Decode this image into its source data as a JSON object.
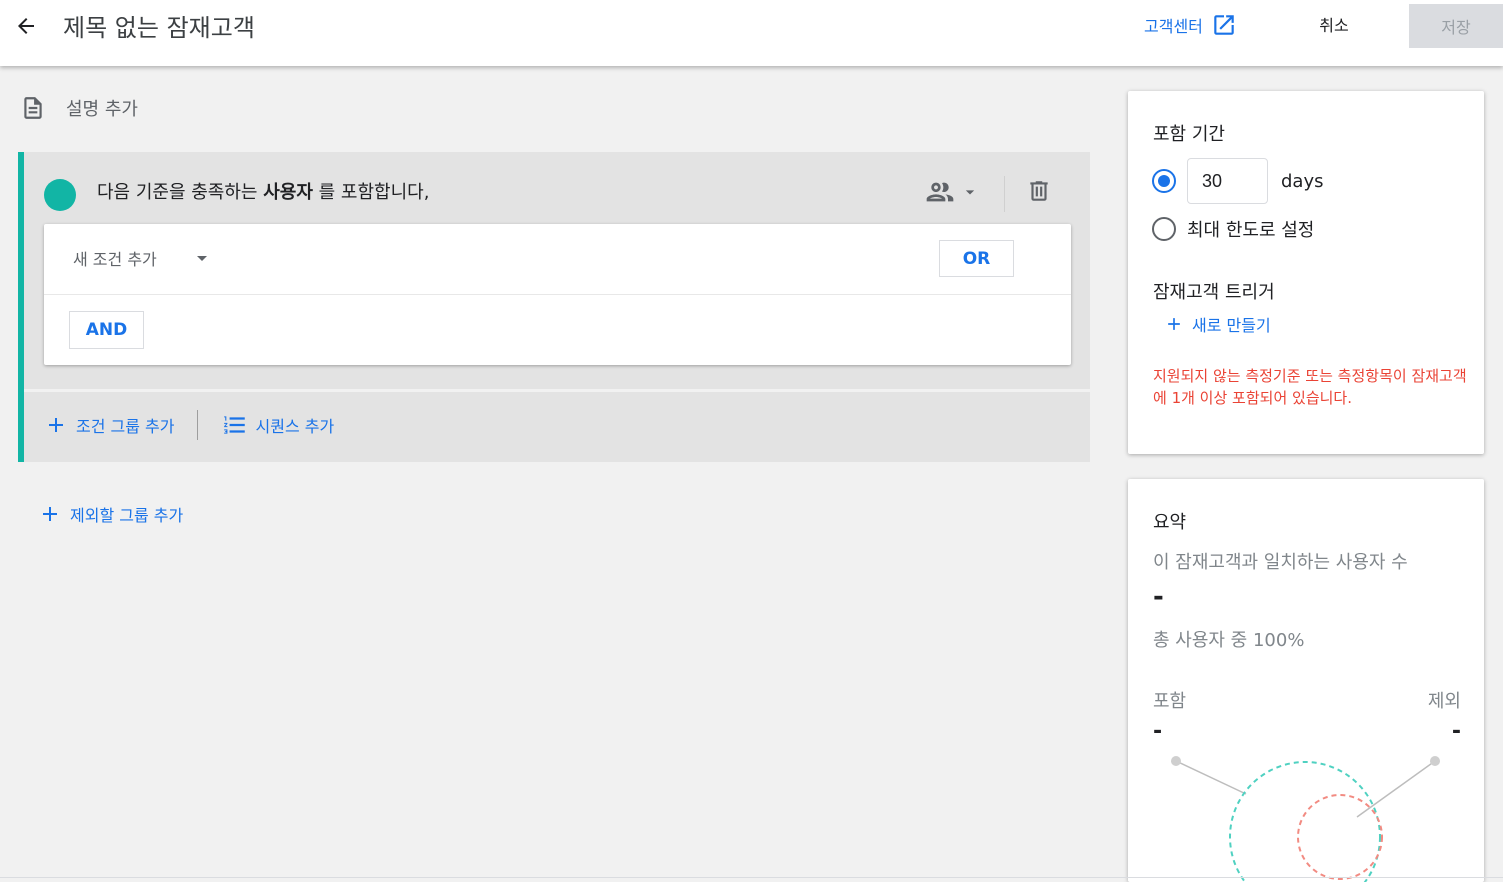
{
  "header": {
    "title": "제목 없는 잠재고객",
    "help_label": "고객센터",
    "cancel_label": "취소",
    "save_label": "저장"
  },
  "description": {
    "label": "설명 추가"
  },
  "include_group": {
    "heading_pre": "다음 기준을 충족하는 ",
    "heading_bold": "사용자",
    "heading_post": " 를 포함합니다,",
    "condition_placeholder": "새 조건 추가",
    "or_label": "OR",
    "and_label": "AND",
    "add_condition_group": "조건 그룹 추가",
    "add_sequence": "시퀀스 추가"
  },
  "exclude": {
    "label": "제외할 그룹 추가"
  },
  "settings": {
    "membership_title": "포함 기간",
    "days_value": "30",
    "days_unit": "days",
    "max_label": "최대 한도로 설정",
    "selected_option": "days",
    "trigger_title": "잠재고객 트리거",
    "trigger_create": "새로 만들기",
    "warning": "지원되지 않는 측정기준 또는 측정항목이 잠재고객에 1개 이상 포함되어 있습니다."
  },
  "summary": {
    "title": "요약",
    "subtitle": "이 잠재고객과 일치하는 사용자 수",
    "count": "-",
    "percent": "총 사용자 중 100%",
    "include_label": "포함",
    "exclude_label": "제외",
    "include_value": "-",
    "exclude_value": "-"
  },
  "colors": {
    "accent": "#1a73e8",
    "include_teal": "#12b5a5",
    "exclude_red": "#f28b82",
    "warning_red": "#ea4335"
  }
}
